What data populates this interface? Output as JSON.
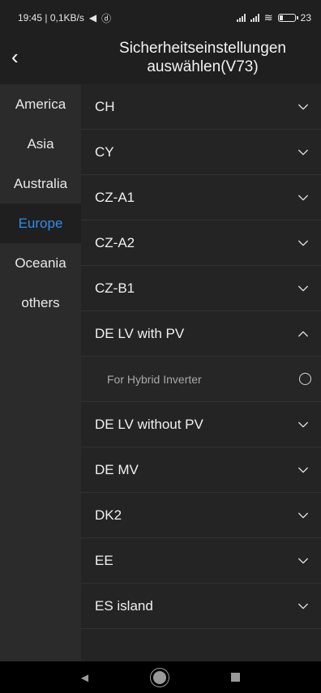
{
  "status_bar": {
    "time_speed": "19:45 | 0,1KB/s",
    "battery": "23",
    "battery_level": 0.23
  },
  "header": {
    "back_icon": "chevron-left-icon",
    "title": "Sicherheitseinstellungen auswählen(V73)"
  },
  "regions": [
    {
      "label": "America",
      "active": false
    },
    {
      "label": "Asia",
      "active": false
    },
    {
      "label": "Australia",
      "active": false
    },
    {
      "label": "Europe",
      "active": true
    },
    {
      "label": "Oceania",
      "active": false
    },
    {
      "label": "others",
      "active": false
    }
  ],
  "colors": {
    "accent": "#2f8ee8",
    "background": "#1f1f1f"
  },
  "standards": [
    {
      "label": "CH",
      "state": "collapsed"
    },
    {
      "label": "CY",
      "state": "collapsed"
    },
    {
      "label": "CZ-A1",
      "state": "collapsed"
    },
    {
      "label": "CZ-A2",
      "state": "collapsed"
    },
    {
      "label": "CZ-B1",
      "state": "collapsed"
    },
    {
      "label": "DE LV with PV",
      "state": "expanded"
    },
    {
      "label": "For Hybrid Inverter",
      "state": "option"
    },
    {
      "label": "DE LV without PV",
      "state": "collapsed"
    },
    {
      "label": "DE MV",
      "state": "collapsed"
    },
    {
      "label": "DK2",
      "state": "collapsed"
    },
    {
      "label": "EE",
      "state": "collapsed"
    },
    {
      "label": "ES island",
      "state": "collapsed"
    }
  ]
}
